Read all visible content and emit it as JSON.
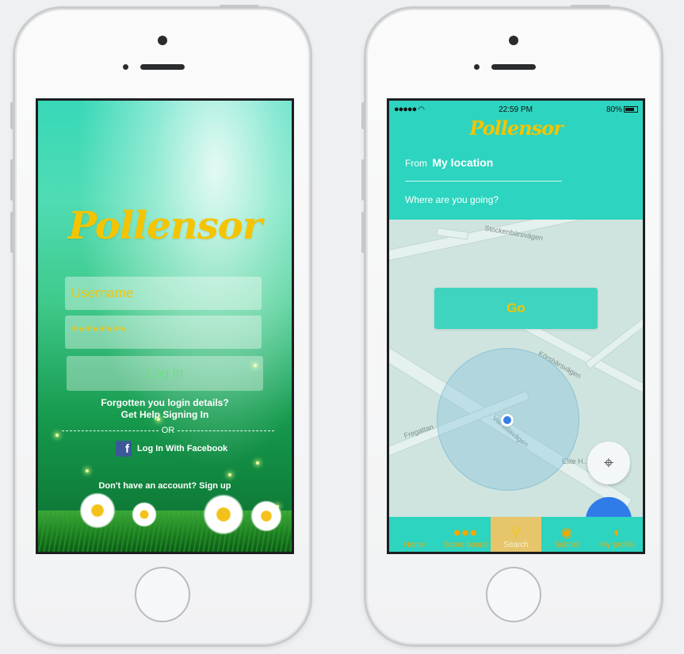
{
  "login": {
    "logo": "Pollensor",
    "username_placeholder": "Username",
    "password_value": "********",
    "login_label": "Log in",
    "forgot_line1": "Forgotten you login details?",
    "forgot_line2": "Get Help Signing In",
    "or_label": "OR",
    "facebook_label": "Log In With Facebook",
    "facebook_icon": "f",
    "signup_text": "Don't have an account? Sign up"
  },
  "map": {
    "status": {
      "signal": "●●●●● ",
      "time": "22:59 PM",
      "battery": "80%"
    },
    "logo": "Pollensor",
    "from_label": "From",
    "from_value": "My location",
    "destination_placeholder": "Where are you going?",
    "go_label": "Go",
    "street_labels": {
      "top": "Stockenbärsvägen",
      "right": "Körsbärsvägen",
      "left": "Fregattan",
      "middle": "Valhallavägen",
      "poi": "Elite H... St..."
    },
    "tabs": [
      {
        "label": "Home",
        "icon": "home-icon"
      },
      {
        "label": "Score board",
        "icon": "group-icon"
      },
      {
        "label": "Search",
        "icon": "search-icon",
        "active": true
      },
      {
        "label": "Submit",
        "icon": "submit-icon"
      },
      {
        "label": "My profile",
        "icon": "profile-icon"
      }
    ]
  },
  "colors": {
    "brand_yellow": "#f5c400",
    "teal": "#2dd4bf",
    "facebook_blue": "#3b5998"
  }
}
